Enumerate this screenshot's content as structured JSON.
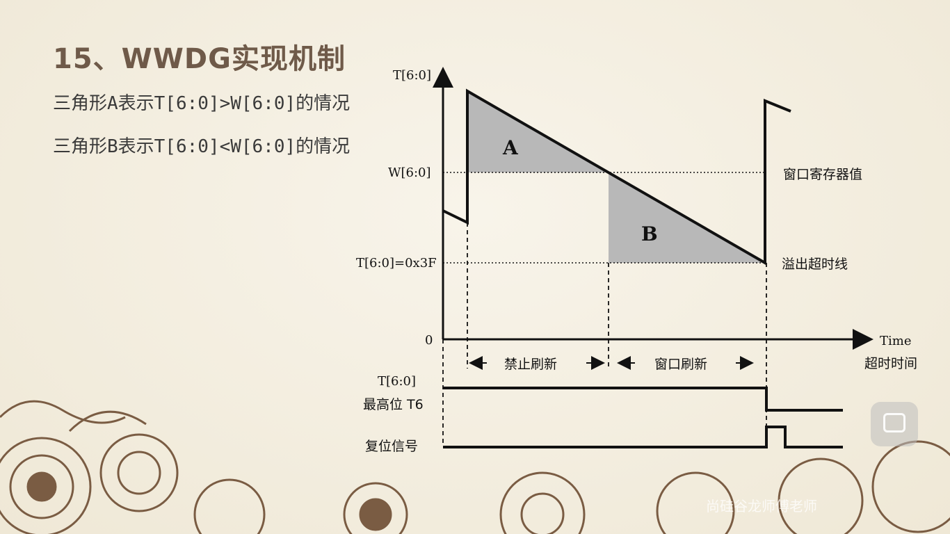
{
  "slide": {
    "title": "15、WWDG实现机制",
    "desc_a": "三角形A表示T[6:0]>W[6:0]的情况",
    "desc_b": "三角形B表示T[6:0]<W[6:0]的情况"
  },
  "diagram": {
    "y_axis_label": "T[6:0]",
    "w_label": "W[6:0]",
    "t3f_label": "T[6:0]=0x3F",
    "zero_label": "0",
    "x_axis_label": "Time",
    "triangle_a": "A",
    "triangle_b": "B",
    "window_reg_label": "窗口寄存器值",
    "overflow_label": "溢出超时线",
    "timeout_label": "超时时间",
    "forbid_refresh": "禁止刷新",
    "window_refresh": "窗口刷新",
    "t_signal_label": "T[6:0]",
    "t6_label": "最高位 T6",
    "reset_label": "复位信号"
  },
  "watermark": "尚硅谷龙师傅老师",
  "colors": {
    "title": "#6f5a49",
    "shade": "#b8b8b8",
    "line": "#111111",
    "background": "#f4efe2",
    "ornament": "#7a5c43"
  }
}
